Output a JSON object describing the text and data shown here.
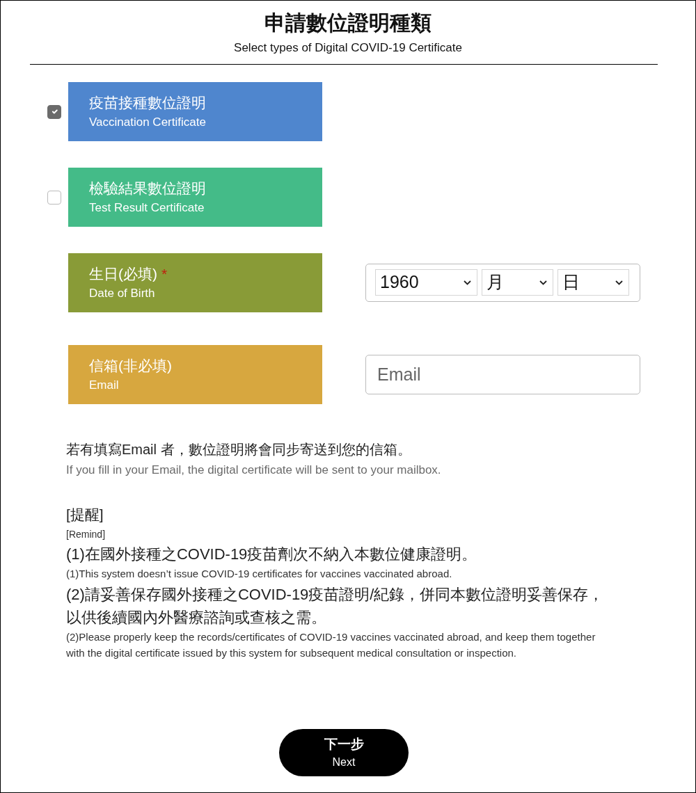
{
  "header": {
    "title": "申請數位證明種類",
    "subtitle": "Select types of Digital COVID-19 Certificate"
  },
  "certificate_types": [
    {
      "label": "疫苗接種數位證明",
      "label_en": "Vaccination Certificate",
      "checked": true,
      "color": "#4f86ce"
    },
    {
      "label": "檢驗結果數位證明",
      "label_en": "Test Result Certificate",
      "checked": false,
      "color": "#44bb88"
    }
  ],
  "fields": [
    {
      "kind": "date",
      "label": "生日(必填)",
      "required_mark": "*",
      "label_en": "Date of Birth",
      "color": "#899b37",
      "selects": [
        {
          "value": "1960"
        },
        {
          "value": "月"
        },
        {
          "value": "日"
        }
      ]
    },
    {
      "kind": "email",
      "label": "信箱(非必填)",
      "label_en": "Email",
      "color": "#d7a73f",
      "placeholder": "Email"
    }
  ],
  "email_note": {
    "text": "若有填寫Email 者，數位證明將會同步寄送到您的信箱。",
    "text_en": "If you fill in your Email, the digital certificate will be sent to your mailbox."
  },
  "reminder": {
    "title": "[提醒]",
    "title_en": "[Remind]",
    "items": [
      {
        "text": "(1)在國外接種之COVID-19疫苗劑次不納入本數位健康證明。",
        "text_en": "(1)This system doesn’t issue COVID-19 certificates for vaccines vaccinated abroad."
      },
      {
        "text": "(2)請妥善保存國外接種之COVID-19疫苗證明/紀錄，併同本數位證明妥善保存，以供後續國內外醫療諮詢或查核之需。",
        "text_en": "(2)Please properly keep the records/certificates of COVID-19 vaccines vaccinated abroad, and keep them together with the digital certificate issued by this system for subsequent medical consultation or inspection."
      }
    ]
  },
  "next_button": {
    "label": "下一步",
    "label_en": "Next"
  }
}
